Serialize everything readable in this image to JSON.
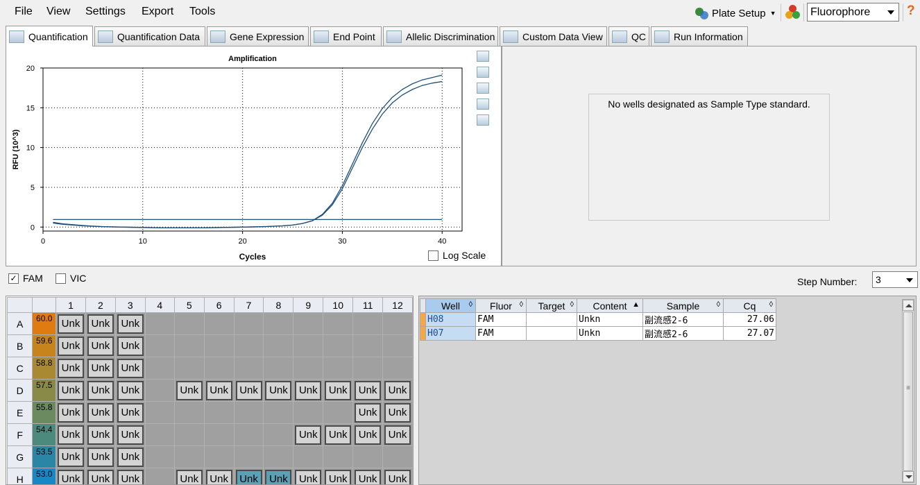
{
  "menu": {
    "file": "File",
    "view": "View",
    "settings": "Settings",
    "export": "Export",
    "tools": "Tools"
  },
  "toolbar": {
    "plate_setup": "Plate Setup",
    "fluorophore": "Fluorophore",
    "help": "?"
  },
  "tabs": [
    {
      "label": "Quantification",
      "active": true
    },
    {
      "label": "Quantification Data"
    },
    {
      "label": "Gene Expression"
    },
    {
      "label": "End Point"
    },
    {
      "label": "Allelic Discrimination"
    },
    {
      "label": "Custom Data View"
    },
    {
      "label": "QC"
    },
    {
      "label": "Run Information"
    }
  ],
  "chart_data": {
    "type": "line",
    "title": "Amplification",
    "xlabel": "Cycles",
    "ylabel": "RFU (10^3)",
    "xlim": [
      0,
      42
    ],
    "ylim": [
      -0.5,
      20
    ],
    "xticks": [
      0,
      10,
      20,
      30,
      40
    ],
    "yticks": [
      0,
      5,
      10,
      15,
      20
    ],
    "grid": true,
    "series": [
      {
        "x": [
          1,
          2,
          3,
          4,
          5,
          6,
          8,
          10,
          12,
          14,
          16,
          18,
          20,
          22,
          24,
          25,
          26,
          27,
          28,
          29,
          30,
          31,
          32,
          33,
          34,
          35,
          36,
          37,
          38,
          39,
          40
        ],
        "y": [
          0.5,
          0.35,
          0.25,
          0.15,
          0.1,
          0.05,
          0,
          -0.05,
          -0.1,
          -0.1,
          -0.1,
          -0.05,
          0,
          0.05,
          0.15,
          0.25,
          0.45,
          0.8,
          1.6,
          3.0,
          5.2,
          7.9,
          10.6,
          13.0,
          14.9,
          16.3,
          17.3,
          18.0,
          18.5,
          18.8,
          19.1
        ],
        "color": "#1f4e79"
      },
      {
        "x": [
          1,
          2,
          3,
          4,
          5,
          6,
          8,
          10,
          12,
          14,
          16,
          18,
          20,
          22,
          24,
          25,
          26,
          27,
          28,
          29,
          30,
          31,
          32,
          33,
          34,
          35,
          36,
          37,
          38,
          39,
          40
        ],
        "y": [
          0.6,
          0.4,
          0.3,
          0.2,
          0.12,
          0.06,
          0,
          -0.05,
          -0.1,
          -0.1,
          -0.1,
          -0.05,
          0,
          0.05,
          0.15,
          0.25,
          0.45,
          0.8,
          1.5,
          2.8,
          4.8,
          7.4,
          10.0,
          12.3,
          14.2,
          15.6,
          16.6,
          17.3,
          17.8,
          18.1,
          18.3
        ],
        "color": "#1f4e79"
      },
      {
        "x": [
          1,
          40
        ],
        "y": [
          0.95,
          0.95
        ],
        "color": "#1f4e79"
      }
    ]
  },
  "chart_options": {
    "log_scale_label": "Log Scale",
    "log_scale_checked": false
  },
  "right_panel": {
    "message": "No wells designated as Sample Type standard."
  },
  "fluor_filter": {
    "fam": "FAM",
    "fam_checked": true,
    "vic": "VIC",
    "vic_checked": false
  },
  "step": {
    "label": "Step Number:",
    "value": "3"
  },
  "plate": {
    "columns": [
      "1",
      "2",
      "3",
      "4",
      "5",
      "6",
      "7",
      "8",
      "9",
      "10",
      "11",
      "12"
    ],
    "rows": [
      {
        "row": "A",
        "temp": "60.0",
        "temp_color": "#e07b12",
        "wells": [
          "Unk",
          "Unk",
          "Unk",
          "",
          "",
          "",
          "",
          "",
          "",
          "",
          "",
          ""
        ]
      },
      {
        "row": "B",
        "temp": "59.6",
        "temp_color": "#c8841c",
        "wells": [
          "Unk",
          "Unk",
          "Unk",
          "",
          "",
          "",
          "",
          "",
          "",
          "",
          "",
          ""
        ]
      },
      {
        "row": "C",
        "temp": "58.8",
        "temp_color": "#a98a32",
        "wells": [
          "Unk",
          "Unk",
          "Unk",
          "",
          "",
          "",
          "",
          "",
          "",
          "",
          "",
          ""
        ]
      },
      {
        "row": "D",
        "temp": "57.5",
        "temp_color": "#8a8a48",
        "wells": [
          "Unk",
          "Unk",
          "Unk",
          "",
          "Unk",
          "Unk",
          "Unk",
          "Unk",
          "Unk",
          "Unk",
          "Unk",
          "Unk"
        ]
      },
      {
        "row": "E",
        "temp": "55.8",
        "temp_color": "#6b8a60",
        "wells": [
          "Unk",
          "Unk",
          "Unk",
          "",
          "",
          "",
          "",
          "",
          "",
          "",
          "Unk",
          "Unk"
        ]
      },
      {
        "row": "F",
        "temp": "54.4",
        "temp_color": "#4b8a7c",
        "wells": [
          "Unk",
          "Unk",
          "Unk",
          "",
          "",
          "",
          "",
          "",
          "Unk",
          "Unk",
          "Unk",
          "Unk"
        ]
      },
      {
        "row": "G",
        "temp": "53.5",
        "temp_color": "#2a86a4",
        "wells": [
          "Unk",
          "Unk",
          "Unk",
          "",
          "",
          "",
          "",
          "",
          "",
          "",
          "",
          ""
        ]
      },
      {
        "row": "H",
        "temp": "53.0",
        "temp_color": "#1788c6",
        "wells": [
          "Unk",
          "Unk",
          "Unk",
          "",
          "Unk",
          "Unk",
          "Unk*",
          "Unk*",
          "Unk",
          "Unk",
          "Unk",
          "Unk"
        ]
      }
    ]
  },
  "results": {
    "headers": [
      "Well",
      "Fluor",
      "Target",
      "Content",
      "Sample",
      "Cq"
    ],
    "rows": [
      {
        "well": "H08",
        "fluor": "FAM",
        "target": "",
        "content": "Unkn",
        "sample": "副流感2-6",
        "cq": "27.06"
      },
      {
        "well": "H07",
        "fluor": "FAM",
        "target": "",
        "content": "Unkn",
        "sample": "副流感2-6",
        "cq": "27.07"
      }
    ]
  }
}
